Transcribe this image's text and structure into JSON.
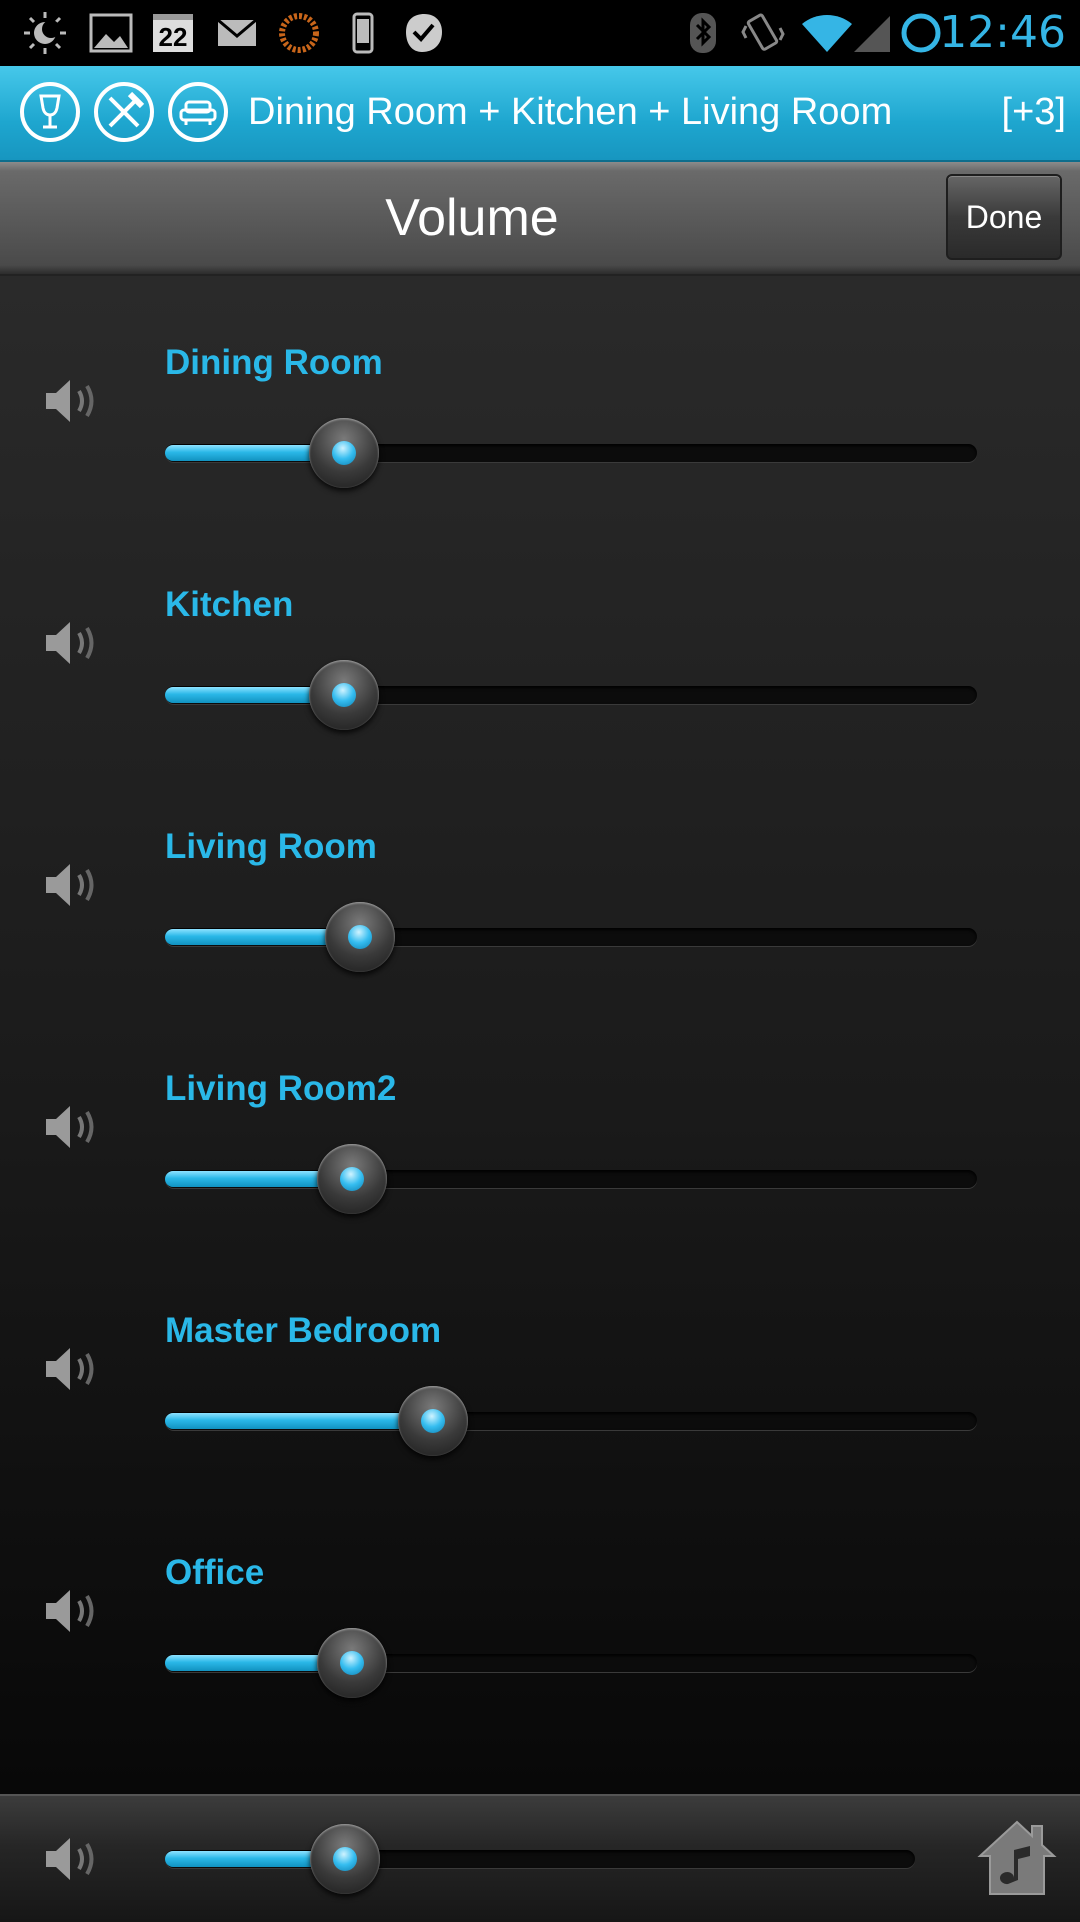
{
  "status_bar": {
    "time": "12:46",
    "calendar_day": "22",
    "icons": [
      "weather-icon",
      "gallery-icon",
      "calendar-icon",
      "mail-icon",
      "sync-orange-icon",
      "phone-icon",
      "task-check-icon",
      "bluetooth-icon",
      "vibrate-icon",
      "wifi-icon",
      "signal-icon",
      "circle-status-icon"
    ]
  },
  "header": {
    "rooms_title": "Dining Room + Kitchen + Living Room",
    "extra_count": "[+3]",
    "room_icons": [
      "wine-glass-icon",
      "fork-knife-icon",
      "sofa-icon"
    ]
  },
  "title_bar": {
    "title": "Volume",
    "done_label": "Done"
  },
  "zones": [
    {
      "name": "Dining Room",
      "volume": 0.22
    },
    {
      "name": "Kitchen",
      "volume": 0.22
    },
    {
      "name": "Living Room",
      "volume": 0.24
    },
    {
      "name": "Living Room2",
      "volume": 0.23
    },
    {
      "name": "Master Bedroom",
      "volume": 0.33
    },
    {
      "name": "Office",
      "volume": 0.23
    }
  ],
  "master": {
    "volume": 0.24
  },
  "colors": {
    "accent": "#2ab8e8",
    "header_bg": "#1ea6cf",
    "status_time": "#35b5e5"
  }
}
